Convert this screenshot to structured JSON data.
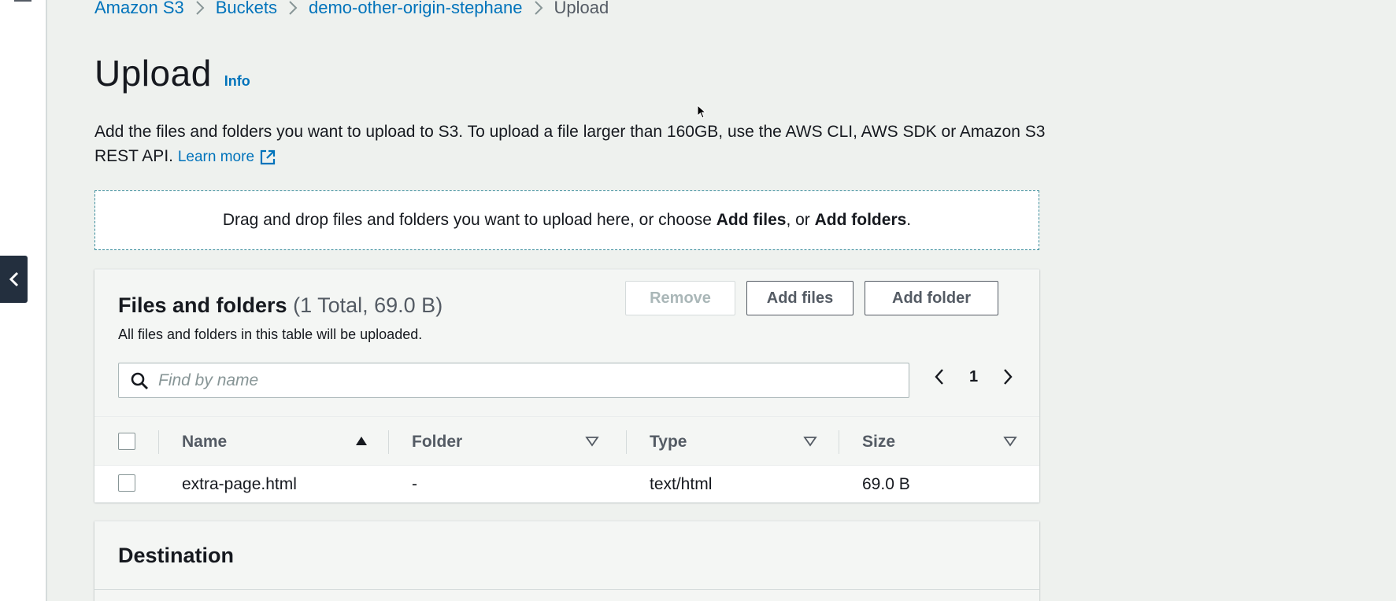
{
  "breadcrumb": {
    "items": [
      "Amazon S3",
      "Buckets",
      "demo-other-origin-stephane"
    ],
    "current": "Upload"
  },
  "page": {
    "title": "Upload",
    "info_link": "Info",
    "description": "Add the files and folders you want to upload to S3. To upload a file larger than 160GB, use the AWS CLI, AWS SDK or Amazon S3 REST API.",
    "learn_more": "Learn more"
  },
  "dropzone": {
    "text_before": "Drag and drop files and folders you want to upload here, or choose ",
    "add_files_bold": "Add files",
    "text_middle": ", or ",
    "add_folders_bold": "Add folders",
    "text_after": "."
  },
  "files_panel": {
    "title": "Files and folders",
    "count": "(1 Total, 69.0 B)",
    "subtitle": "All files and folders in this table will be uploaded.",
    "buttons": {
      "remove": "Remove",
      "add_files": "Add files",
      "add_folder": "Add folder"
    },
    "search_placeholder": "Find by name",
    "page_number": "1",
    "columns": [
      "Name",
      "Folder",
      "Type",
      "Size"
    ],
    "rows": [
      {
        "name": "extra-page.html",
        "folder": "-",
        "type": "text/html",
        "size": "69.0 B"
      }
    ]
  },
  "destination": {
    "title": "Destination"
  },
  "icons": {
    "search": "search-icon",
    "external_link": "external-link-icon",
    "sort_asc": "sort-ascending-icon",
    "sort_filter": "sort-triangle-icon",
    "prev": "chevron-left-icon",
    "next": "chevron-right-icon",
    "collapse": "chevron-left-icon"
  },
  "colors": {
    "link": "#0073bb",
    "background": "#eef1ee",
    "nav_dark": "#232f3e",
    "dropzone_border": "#3b8d9c"
  }
}
